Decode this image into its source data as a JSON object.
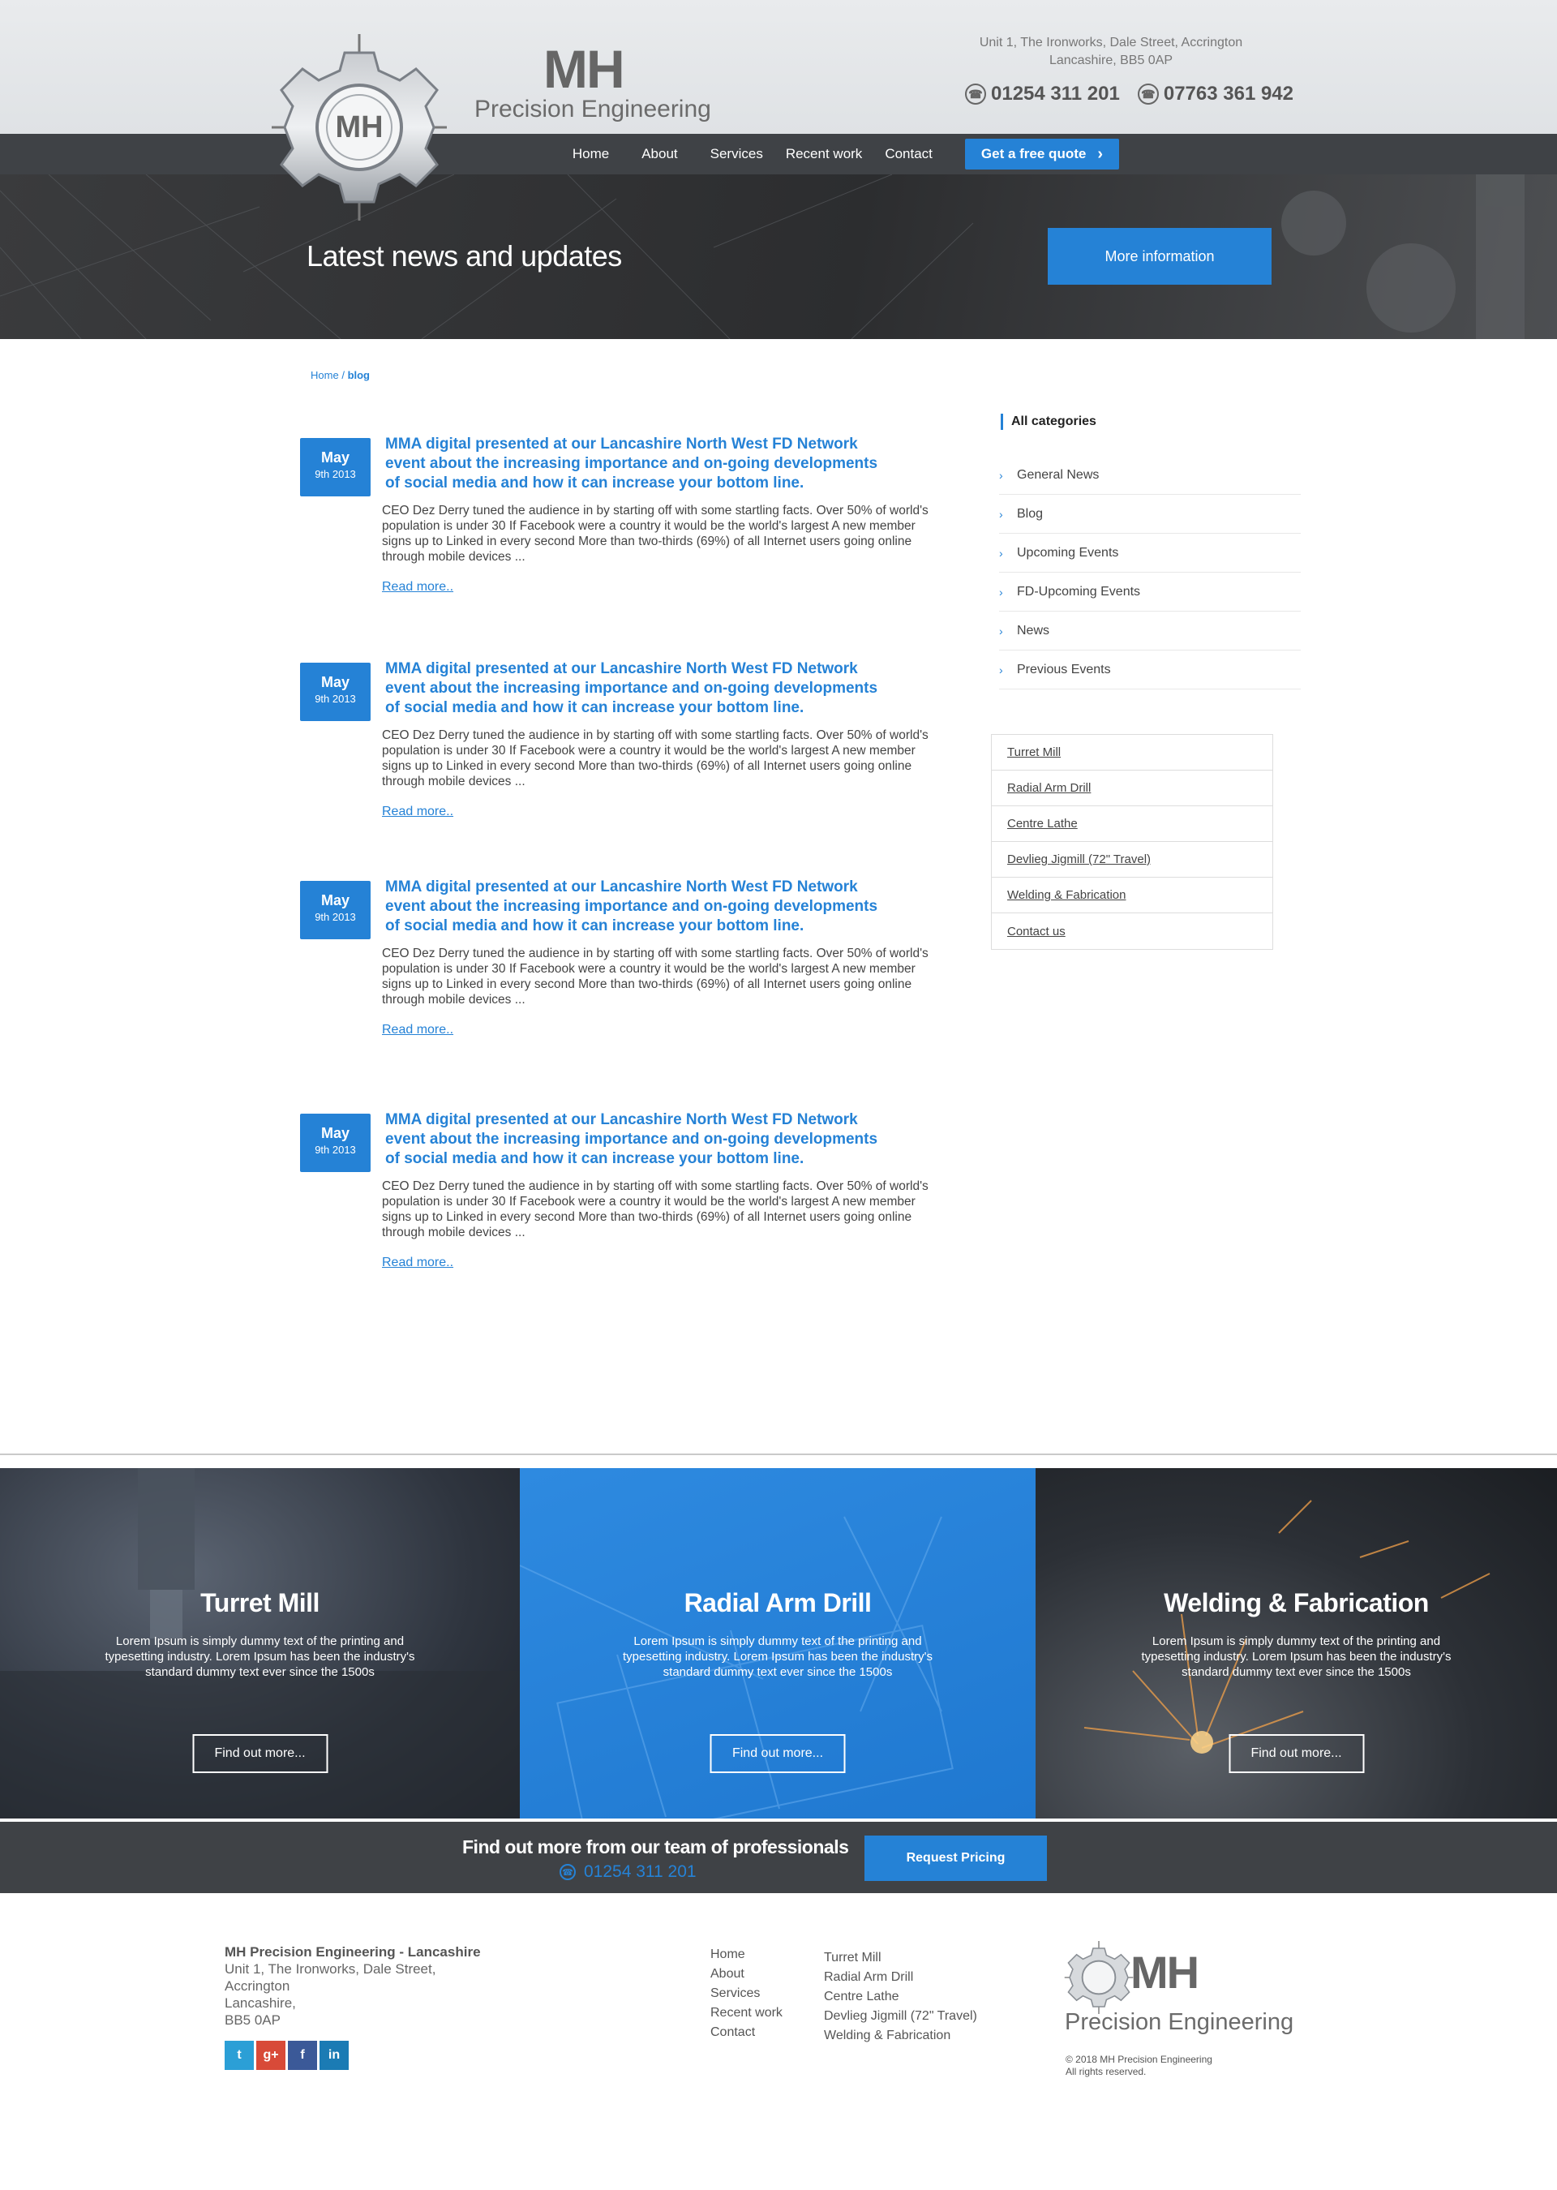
{
  "header": {
    "brand_initials": "MH",
    "brand_name": "Precision Engineering",
    "address_line1": "Unit 1, The Ironworks, Dale Street, Accrington",
    "address_line2": "Lancashire, BB5 0AP",
    "phone1": "01254 311 201",
    "phone2": "07763 361 942"
  },
  "nav": {
    "items": [
      "Home",
      "About",
      "Services",
      "Recent work",
      "Contact"
    ],
    "quote_label": "Get a free quote"
  },
  "hero": {
    "title": "Latest news and updates",
    "button": "More information"
  },
  "breadcrumb": {
    "home": "Home",
    "sep": "/",
    "current": "blog"
  },
  "posts": [
    {
      "month": "May",
      "day": "9th 2013",
      "title": "MMA digital presented at our Lancashire North West FD Network event about the increasing importance and on-going developments of social media and how it can increase your bottom line.",
      "body": "CEO Dez Derry tuned the audience in by starting off with some startling facts. Over 50% of world's population is under 30 If Facebook were a country it would be the world's largest A new member signs up to Linked in every second More than two-thirds (69%) of all Internet users going online through mobile devices ...",
      "read_more": "Read more.."
    },
    {
      "month": "May",
      "day": "9th 2013",
      "title": "MMA digital presented at our Lancashire North West FD Network event about the increasing importance and on-going developments of social media and how it can increase your bottom line.",
      "body": "CEO Dez Derry tuned the audience in by starting off with some startling facts. Over 50% of world's population is under 30 If Facebook were a country it would be the world's largest A new member signs up to Linked in every second More than two-thirds (69%) of all Internet users going online through mobile devices ...",
      "read_more": "Read more.."
    },
    {
      "month": "May",
      "day": "9th 2013",
      "title": "MMA digital presented at our Lancashire North West FD Network event about the increasing importance and on-going developments of social media and how it can increase your bottom line.",
      "body": "CEO Dez Derry tuned the audience in by starting off with some startling facts. Over 50% of world's population is under 30 If Facebook were a country it would be the world's largest A new member signs up to Linked in every second More than two-thirds (69%) of all Internet users going online through mobile devices ...",
      "read_more": "Read more.."
    },
    {
      "month": "May",
      "day": "9th 2013",
      "title": "MMA digital presented at our Lancashire North West FD Network event about the increasing importance and on-going developments of social media and how it can increase your bottom line.",
      "body": "CEO Dez Derry tuned the audience in by starting off with some startling facts. Over 50% of world's population is under 30 If Facebook were a country it would be the world's largest A new member signs up to Linked in every second More than two-thirds (69%) of all Internet users going online through mobile devices ...",
      "read_more": "Read more.."
    }
  ],
  "sidebar": {
    "categories_title": "All categories",
    "categories": [
      "General News",
      "Blog",
      "Upcoming Events",
      "FD-Upcoming Events",
      "News",
      "Previous Events"
    ],
    "links": [
      "Turret Mill",
      "Radial Arm Drill",
      "Centre Lathe",
      "Devlieg Jigmill (72\" Travel)",
      "Welding & Fabrication",
      "Contact us"
    ]
  },
  "features": [
    {
      "title": "Turret Mill",
      "text": "Lorem Ipsum is simply dummy text of the printing and typesetting industry. Lorem Ipsum has been the industry's standard dummy text ever since the 1500s",
      "button": "Find out more..."
    },
    {
      "title": "Radial Arm Drill",
      "text": "Lorem Ipsum is simply dummy text of the printing and typesetting industry. Lorem Ipsum has been the industry's standard dummy text ever since the 1500s",
      "button": "Find out more..."
    },
    {
      "title": "Welding & Fabrication",
      "text": "Lorem Ipsum is simply dummy text of the printing and typesetting industry. Lorem Ipsum has been the industry's standard dummy text ever since the 1500s",
      "button": "Find out more..."
    }
  ],
  "cta": {
    "title": "Find out more from our team of professionals",
    "phone": "01254 311 201",
    "button": "Request Pricing"
  },
  "footer": {
    "company": "MH Precision Engineering - Lancashire",
    "address": [
      "Unit 1, The Ironworks, Dale Street,",
      "Accrington",
      "Lancashire,",
      "BB5 0AP"
    ],
    "social": [
      {
        "icon": "twitter-icon",
        "glyph": "t",
        "color": "#2b9fd6"
      },
      {
        "icon": "google-plus-icon",
        "glyph": "g+",
        "color": "#d84a38"
      },
      {
        "icon": "facebook-icon",
        "glyph": "f",
        "color": "#3b5998"
      },
      {
        "icon": "linkedin-icon",
        "glyph": "in",
        "color": "#1b7bb4"
      }
    ],
    "nav": [
      "Home",
      "About",
      "Services",
      "Recent work",
      "Contact"
    ],
    "services": [
      "Turret Mill",
      "Radial Arm Drill",
      "Centre Lathe",
      "Devlieg Jigmill (72\" Travel)",
      "Welding & Fabrication"
    ],
    "logo_initials": "MH",
    "logo_name": "Precision Engineering",
    "copyright": "© 2018 MH Precision Engineering",
    "rights": "All rights reserved."
  },
  "colors": {
    "accent": "#2582d6",
    "dark_band": "#3f4246"
  }
}
